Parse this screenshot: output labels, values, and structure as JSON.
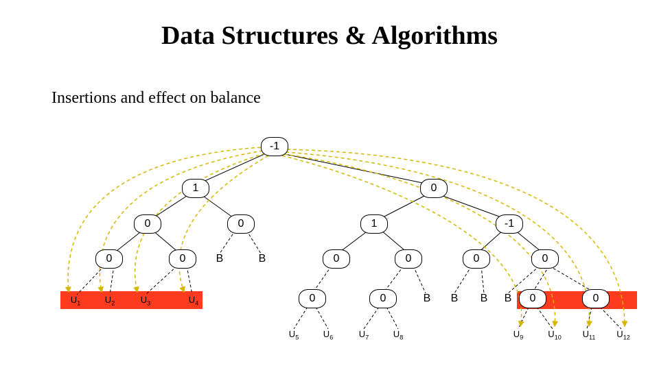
{
  "title": "Data Structures & Algorithms",
  "subtitle": "Insertions and effect on balance",
  "nodes": {
    "root": "-1",
    "l": "1",
    "r": "0",
    "ll": "0",
    "lr": "0",
    "rl": "1",
    "rr": "-1",
    "lll": "0",
    "llr": "0",
    "lrl": "B",
    "lrr": "B",
    "rll": "0",
    "rlr": "0",
    "rrl": "0",
    "rrr": "0",
    "rlll": "0",
    "rlrl": "0",
    "rlrr": "B",
    "rrll": "B",
    "rrlr": "B",
    "rrrl0": "B",
    "rrrl": "0",
    "rrrr": "0"
  },
  "leaves": {
    "u1": "U<sub>1</sub>",
    "u2": "U<sub>2</sub>",
    "u3": "U<sub>3</sub>",
    "u4": "U<sub>4</sub>",
    "u5": "U<sub>5</sub>",
    "u6": "U<sub>6</sub>",
    "u7": "U<sub>7</sub>",
    "u8": "U<sub>8</sub>",
    "u9": "U<sub>9</sub>",
    "u10": "U<sub>10</sub>",
    "u11": "U<sub>11</sub>",
    "u12": "U<sub>12</sub>"
  }
}
